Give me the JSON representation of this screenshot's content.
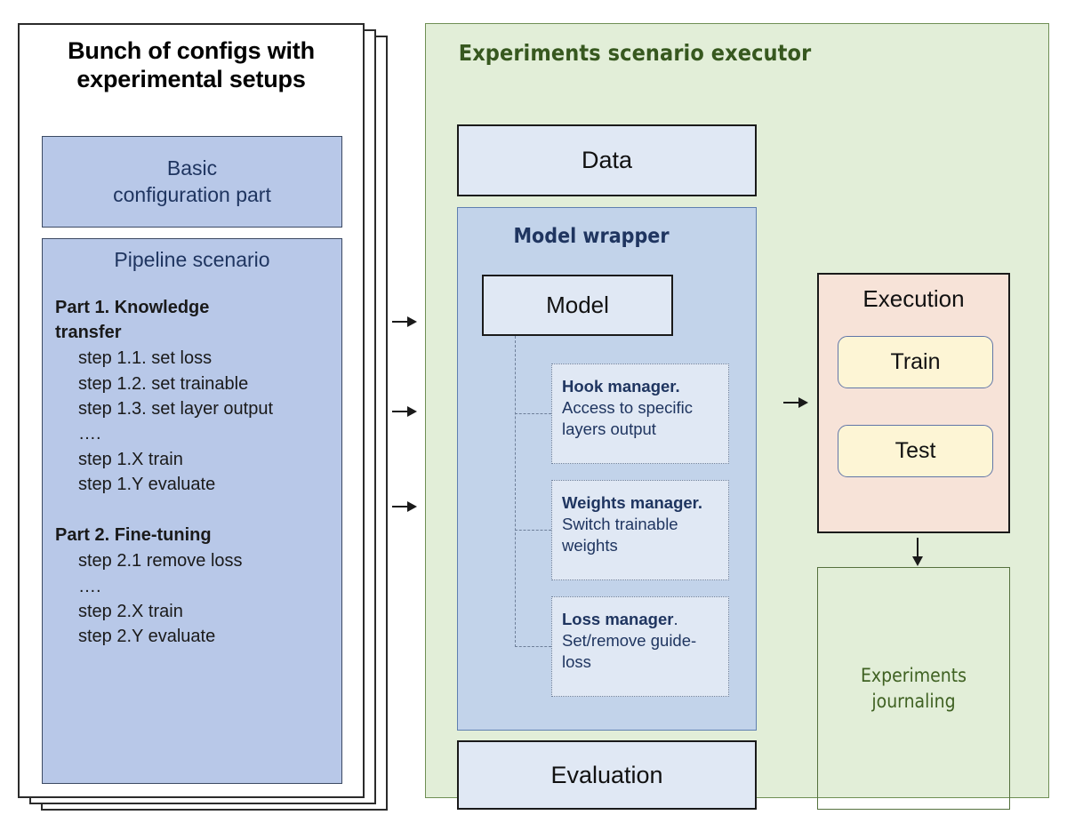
{
  "config_card": {
    "title_line_1": "Bunch of configs with",
    "title_line_2": "experimental setups",
    "basic_box": {
      "line_1": "Basic",
      "line_2": "configuration  part"
    },
    "pipeline_box": {
      "title": "Pipeline scenario",
      "part_1": {
        "heading_line_1": "Part 1. Knowledge",
        "heading_line_2": "transfer",
        "steps": [
          "step 1.1. set loss",
          "step 1.2. set trainable",
          "step 1.3. set layer output",
          "….",
          "step 1.X train",
          "step 1.Y evaluate"
        ]
      },
      "part_2": {
        "heading": "Part 2. Fine-tuning",
        "steps": [
          "step 2.1 remove loss",
          "….",
          "step 2.X train",
          "step 2.Y evaluate"
        ]
      }
    }
  },
  "executor": {
    "title": "Experiments scenario executor",
    "data_label": "Data",
    "evaluation_label": "Evaluation",
    "model_wrapper": {
      "title": "Model wrapper",
      "model_label": "Model",
      "managers": [
        {
          "name": "Hook manager.",
          "description": " Access to specific layers output"
        },
        {
          "name": "Weights manager.",
          "description": " Switch trainable weights"
        },
        {
          "name": "Loss manager",
          "description": ". Set/remove guide-loss"
        }
      ]
    },
    "execution": {
      "title": "Execution",
      "buttons": [
        {
          "label": "Train"
        },
        {
          "label": "Test"
        }
      ]
    },
    "journaling": {
      "line_1": "Experiments",
      "line_2": "journaling"
    }
  },
  "colors": {
    "config_fill": "#b8c8e8",
    "executor_fill": "#e2eed8",
    "wrapper_fill": "#c2d3ea",
    "box_fill": "#e0e8f4",
    "execution_fill": "#f7e3d8",
    "run_button_fill": "#fdf5d5",
    "green_text": "#37581f",
    "navy_text": "#1f3560"
  }
}
